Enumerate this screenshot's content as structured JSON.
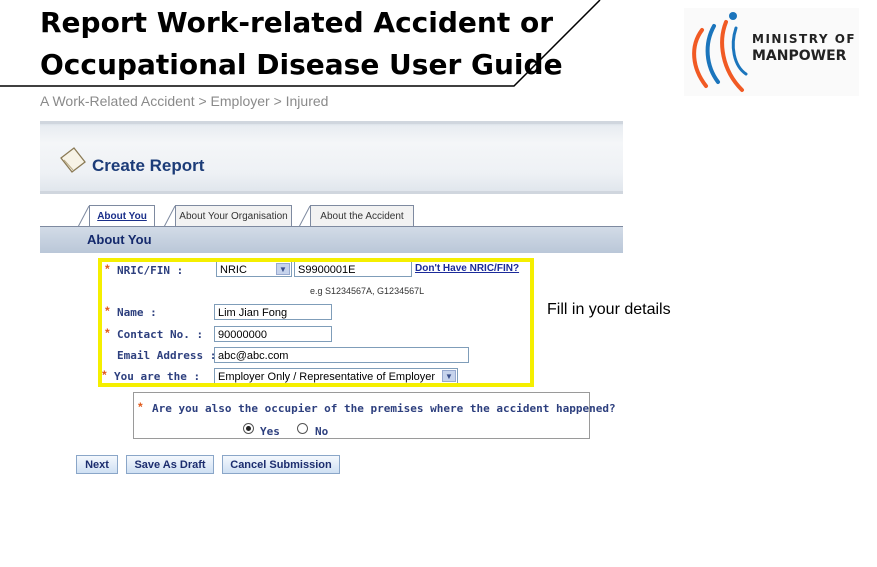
{
  "guide": {
    "title_line1": "Report Work-related Accident or",
    "title_line2": "Occupational Disease User Guide",
    "breadcrumb": "A Work-Related Accident > Employer > Injured"
  },
  "logo": {
    "line1": "MINISTRY OF",
    "line2": "MANPOWER",
    "colors": [
      "#f15a24",
      "#1b75bc"
    ]
  },
  "form": {
    "header_title": "Create Report",
    "tabs": [
      {
        "label": "About You",
        "active": true
      },
      {
        "label": "About Your Organisation",
        "active": false
      },
      {
        "label": "About the Accident",
        "active": false
      }
    ],
    "section_title": "About You",
    "fields": {
      "id_label": "NRIC/FIN :",
      "id_type": "NRIC",
      "id_value": "S9900001E",
      "no_nric_link": "Don't Have NRIC/FIN?",
      "id_hint": "e.g S1234567A, G1234567L",
      "name_label": "Name :",
      "name_value": "Lim Jian Fong",
      "contact_label": "Contact No. :",
      "contact_value": "90000000",
      "email_label": "Email Address :",
      "email_value": "abc@abc.com",
      "role_label": "You are the :",
      "role_value": "Employer Only / Representative of Employer"
    },
    "required_marker": "*",
    "occupier_question": "Are you also the occupier of the premises where the accident happened?",
    "occupier_options": [
      {
        "label": "Yes",
        "selected": true
      },
      {
        "label": "No",
        "selected": false
      }
    ],
    "buttons": {
      "next": "Next",
      "save_draft": "Save As Draft",
      "cancel": "Cancel Submission"
    }
  },
  "annotation": {
    "text": "Fill in your details",
    "highlight_color": "#f5ef00"
  }
}
